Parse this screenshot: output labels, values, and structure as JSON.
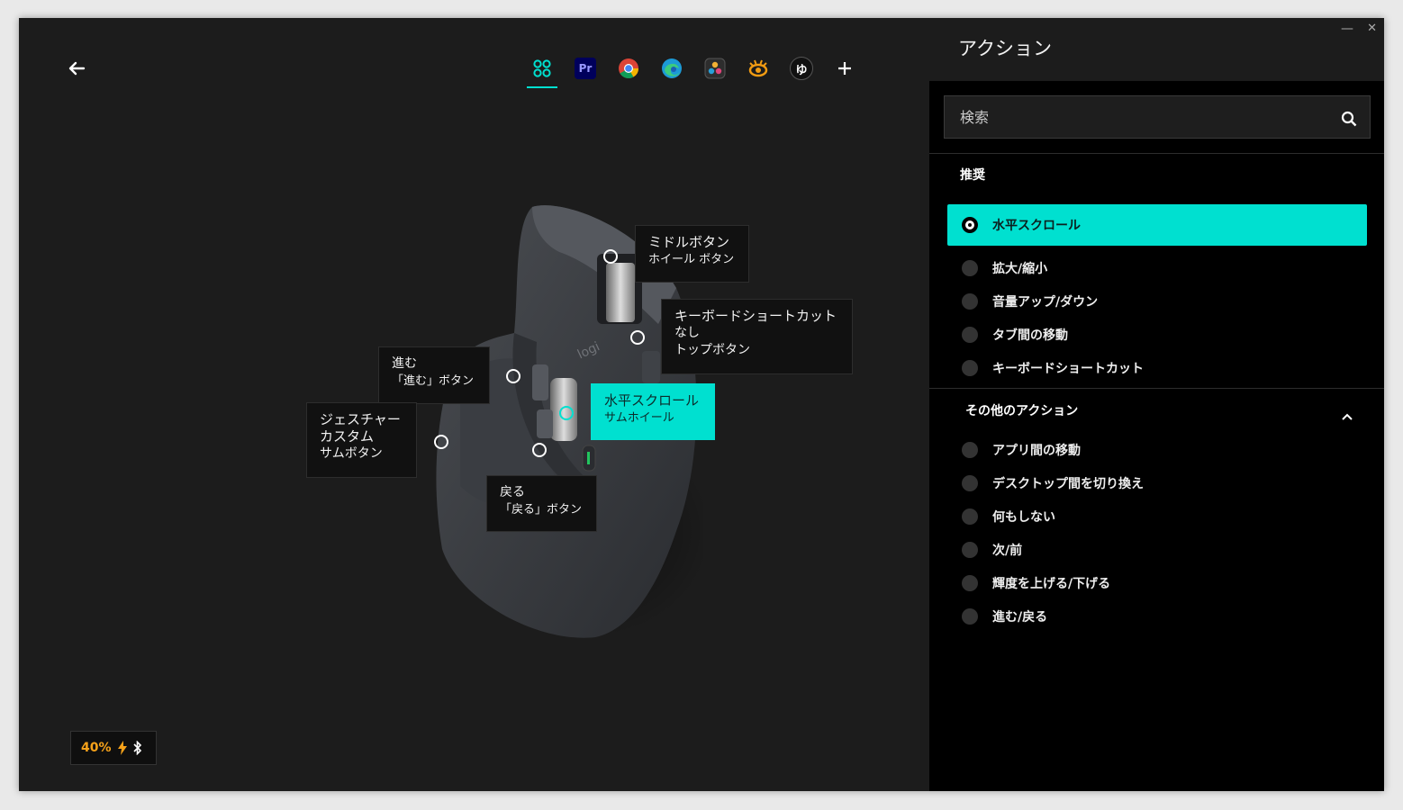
{
  "toolbar": {
    "apps": [
      {
        "name": "all-apps",
        "label": "88"
      },
      {
        "name": "premiere",
        "label": "Pr"
      },
      {
        "name": "chrome",
        "label": ""
      },
      {
        "name": "edge",
        "label": ""
      },
      {
        "name": "davinci",
        "label": ""
      },
      {
        "name": "xnview",
        "label": ""
      },
      {
        "name": "yu",
        "label": "ゆ"
      },
      {
        "name": "add",
        "label": "+"
      }
    ]
  },
  "callouts": {
    "middle": {
      "line1": "ミドルボタン",
      "line2": "ホイール ボタン"
    },
    "top": {
      "line1": "キーボードショートカット",
      "line2": "なし",
      "line3": "トップボタン"
    },
    "forward": {
      "line1": "進む",
      "line2": "「進む」ボタン"
    },
    "thumbwheel": {
      "line1": "水平スクロール",
      "line2": "サムホイール"
    },
    "gesture": {
      "line1": "ジェスチャー",
      "line2": "カスタム",
      "line3": "サムボタン"
    },
    "back": {
      "line1": "戻る",
      "line2": "「戻る」ボタン"
    }
  },
  "battery": {
    "percent": "40%"
  },
  "panel": {
    "title": "アクション",
    "search_placeholder": "検索",
    "recommended_title": "推奨",
    "recommended": [
      "水平スクロール",
      "拡大/縮小",
      "音量アップ/ダウン",
      "タブ間の移動",
      "キーボードショートカット"
    ],
    "other_title": "その他のアクション",
    "other": [
      "アプリ間の移動",
      "デスクトップ間を切り換え",
      "何もしない",
      "次/前",
      "輝度を上げる/下げる",
      "進む/戻る"
    ]
  },
  "colors": {
    "accent": "#00e0d0",
    "battery": "#f6a21a"
  }
}
